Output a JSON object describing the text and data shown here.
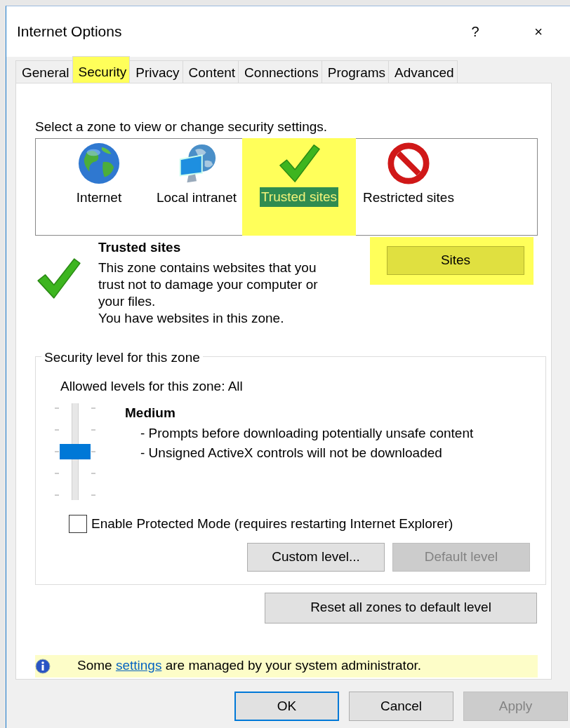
{
  "window": {
    "title": "Internet Options",
    "help": "?",
    "close": "×"
  },
  "tabs": [
    {
      "label": "General",
      "selected": false,
      "highlighted": false
    },
    {
      "label": "Security",
      "selected": true,
      "highlighted": true
    },
    {
      "label": "Privacy",
      "selected": false,
      "highlighted": false
    },
    {
      "label": "Content",
      "selected": false,
      "highlighted": false
    },
    {
      "label": "Connections",
      "selected": false,
      "highlighted": false
    },
    {
      "label": "Programs",
      "selected": false,
      "highlighted": false
    },
    {
      "label": "Advanced",
      "selected": false,
      "highlighted": false
    }
  ],
  "zone_prompt": "Select a zone to view or change security settings.",
  "zones": [
    {
      "kind": "internet",
      "label": "Internet",
      "selected": false,
      "highlighted": false
    },
    {
      "kind": "intranet",
      "label": "Local intranet",
      "selected": false,
      "highlighted": false
    },
    {
      "kind": "trusted",
      "label": "Trusted sites",
      "selected": true,
      "highlighted": true
    },
    {
      "kind": "restricted",
      "label": "Restricted sites",
      "selected": false,
      "highlighted": false
    }
  ],
  "zone_detail": {
    "kind": "trusted",
    "title": "Trusted sites",
    "description": "This zone contains websites that you trust not to damage your computer or your files.",
    "note": "You have websites in this zone.",
    "sites_button": {
      "label": "Sites",
      "highlighted": true
    }
  },
  "security_level": {
    "title": "Security level for this zone",
    "allowed": "Allowed levels for this zone: All",
    "level": 0.5,
    "level_name": "Medium",
    "bullets": [
      "- Prompts before downloading potentially unsafe content",
      "- Unsigned ActiveX controls will not be downloaded"
    ],
    "protected_mode": {
      "label": "Enable Protected Mode (requires restarting Internet Explorer)",
      "checked": false
    },
    "buttons": [
      {
        "label": "Custom level...",
        "disabled": false
      },
      {
        "label": "Default level",
        "disabled": true
      }
    ]
  },
  "reset_button": {
    "label": "Reset all zones to default level"
  },
  "info": {
    "before": "Some ",
    "link": "settings",
    "after": " are managed by your system administrator."
  },
  "footer_buttons": [
    {
      "label": "OK",
      "default": true,
      "disabled": false
    },
    {
      "label": "Cancel",
      "default": false,
      "disabled": false
    },
    {
      "label": "Apply",
      "default": false,
      "disabled": true
    }
  ]
}
